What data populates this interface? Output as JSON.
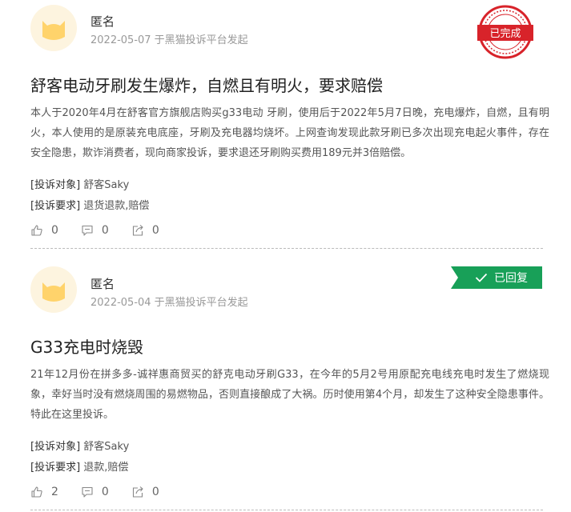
{
  "complaints": [
    {
      "author": "匿名",
      "meta": "2022-05-07 于黑猫投诉平台发起",
      "status": "已完成",
      "title": "舒客电动牙刷发生爆炸，自燃且有明火，要求赔偿",
      "body": "本人于2020年4月在舒客官方旗舰店购买g33电动 牙刷，使用后于2022年5月7日晚，充电爆炸，自燃，且有明火，本人使用的是原装充电底座，牙刷及充电器均烧坏。上网查询发现此款牙刷已多次出现充电起火事件，存在安全隐患，欺诈消费者，现向商家投诉，要求退还牙刷购买费用189元并3倍赔偿。",
      "target_label": "[投诉对象]",
      "target_value": "舒客Saky",
      "request_label": "[投诉要求]",
      "request_value": "退货退款,赔偿",
      "likes": "0",
      "comments": "0",
      "shares": "0"
    },
    {
      "author": "匿名",
      "meta": "2022-05-04 于黑猫投诉平台发起",
      "status": "已回复",
      "title": "G33充电时烧毁",
      "body": "21年12月份在拼多多-诚祥惠商贸买的舒克电动牙刷G33，在今年的5月2号用原配充电线充电时发生了燃烧现象，幸好当时没有燃烧周围的易燃物品，否则直接酿成了大祸。历时使用第4个月，却发生了这种安全隐患事件。特此在这里投诉。",
      "target_label": "[投诉对象]",
      "target_value": "舒客Saky",
      "request_label": "[投诉要求]",
      "request_value": "退款,赔偿",
      "likes": "2",
      "comments": "0",
      "shares": "0"
    }
  ],
  "colors": {
    "stamp_red": "#d8232a",
    "replied_green": "#18a058",
    "avatar_bg": "#fdf4df",
    "cat": "#ffd36b"
  },
  "icons": [
    "cat-avatar-icon",
    "like-icon",
    "comment-icon",
    "share-icon",
    "check-icon"
  ]
}
